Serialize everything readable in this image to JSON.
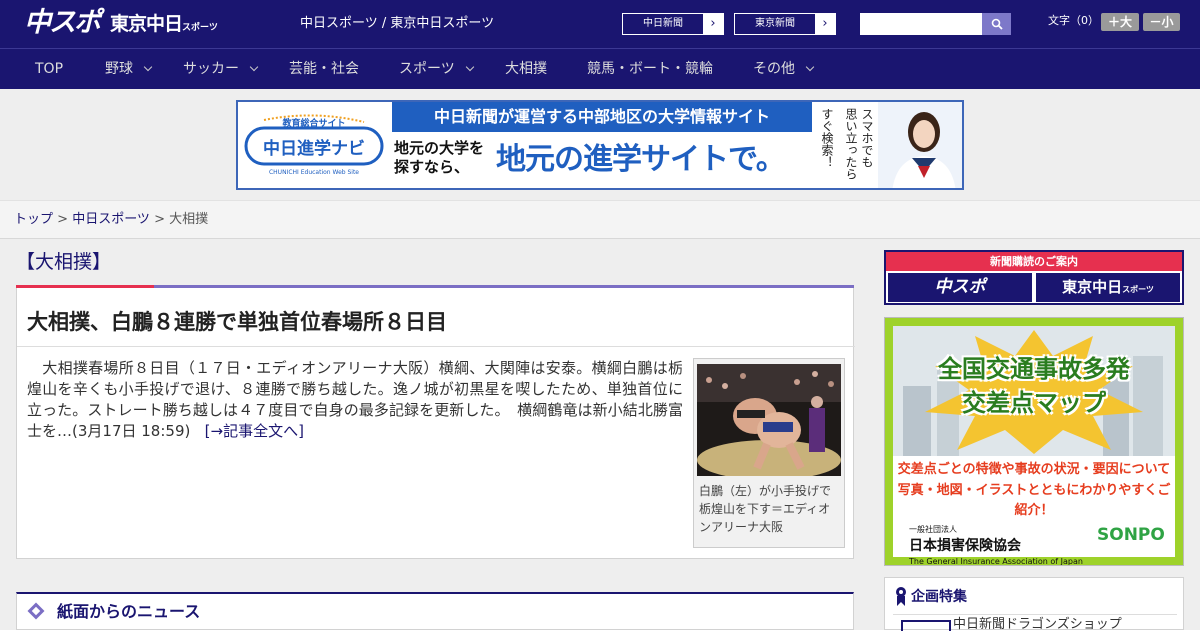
{
  "header": {
    "logo_chuspo": "中スポ",
    "logo_tokyo": "東京中日",
    "logo_tokyo_small": "スポーツ",
    "site_links": "中日スポーツ / 東京中日スポーツ",
    "chunichi_btn": "中日新聞",
    "tokyo_btn": "東京新聞",
    "arrow": "›",
    "search_placeholder": "",
    "search_icon": "search-icon",
    "font_label": "文字（0）",
    "font_bigger": "＋大",
    "font_smaller": "－小"
  },
  "nav": {
    "items": [
      {
        "label": "TOP"
      },
      {
        "label": "野球"
      },
      {
        "label": "サッカー"
      },
      {
        "label": "芸能・社会"
      },
      {
        "label": "スポーツ"
      },
      {
        "label": "大相撲"
      },
      {
        "label": "競馬・ボート・競輪"
      },
      {
        "label": "その他"
      }
    ]
  },
  "banner": {
    "logo_small": "教育総合サイト",
    "logo_main": "中日進学ナビ",
    "logo_en": "CHUNICHI Education Web Site",
    "top_text": "中日新聞が運営する中部地区の大学情報サイト",
    "left_text_1": "地元の大学を",
    "left_text_2": "探すなら、",
    "big_text": "地元の進学サイトで。",
    "vertical_1": "スマホでも",
    "vertical_2": "思い立ったら",
    "vertical_3": "すぐ検索！"
  },
  "breadcrumb": {
    "top": "トップ",
    "sep": " > ",
    "chunichi": "中日スポーツ",
    "current": "大相撲"
  },
  "article": {
    "category": "【大相撲】",
    "headline": "大相撲、白鵬８連勝で単独首位春場所８日目",
    "body": "　大相撲春場所８日目（１７日・エディオンアリーナ大阪）横綱、大関陣は安泰。横綱白鵬は栃煌山を辛くも小手投げで退け、８連勝で勝ち越した。逸ノ城が初黒星を喫したため、単独首位に立った。ストレート勝ち越しは４７度目で自身の最多記録を更新した。　横綱鶴竜は新小結北勝富士を…",
    "timestamp": "(3月17日 18:59)",
    "more_link": "[→記事全文へ]",
    "photo_caption": "白鵬（左）が小手投げで栃煌山を下す＝エディオンアリーナ大阪"
  },
  "news_section": {
    "title": "紙面からのニュース"
  },
  "sidebar": {
    "subscription_title": "新聞購読のご案内",
    "sub_chuspo": "中スポ",
    "sub_tokyo": "東京中日",
    "sub_tokyo_small": "スポーツ",
    "ad_title_1": "全国交通事故多発",
    "ad_title_2": "交差点マップ",
    "ad_sub_1": "交差点ごとの特徴や事故の状況・要因について",
    "ad_sub_2": "写真・地図・イラストとともにわかりやすくご紹介！",
    "ad_org_small": "一般社団法人",
    "ad_org": "日本損害保険協会",
    "ad_org_en": "The General Insurance Association of Japan",
    "ad_logo": "SONPO",
    "kikaku_title": "企画特集",
    "kikaku_item": "中日新聞ドラゴンズショップ"
  },
  "colors": {
    "brand_navy": "#1a1570",
    "accent_red": "#e6304f",
    "accent_purple": "#7b6ec4"
  }
}
